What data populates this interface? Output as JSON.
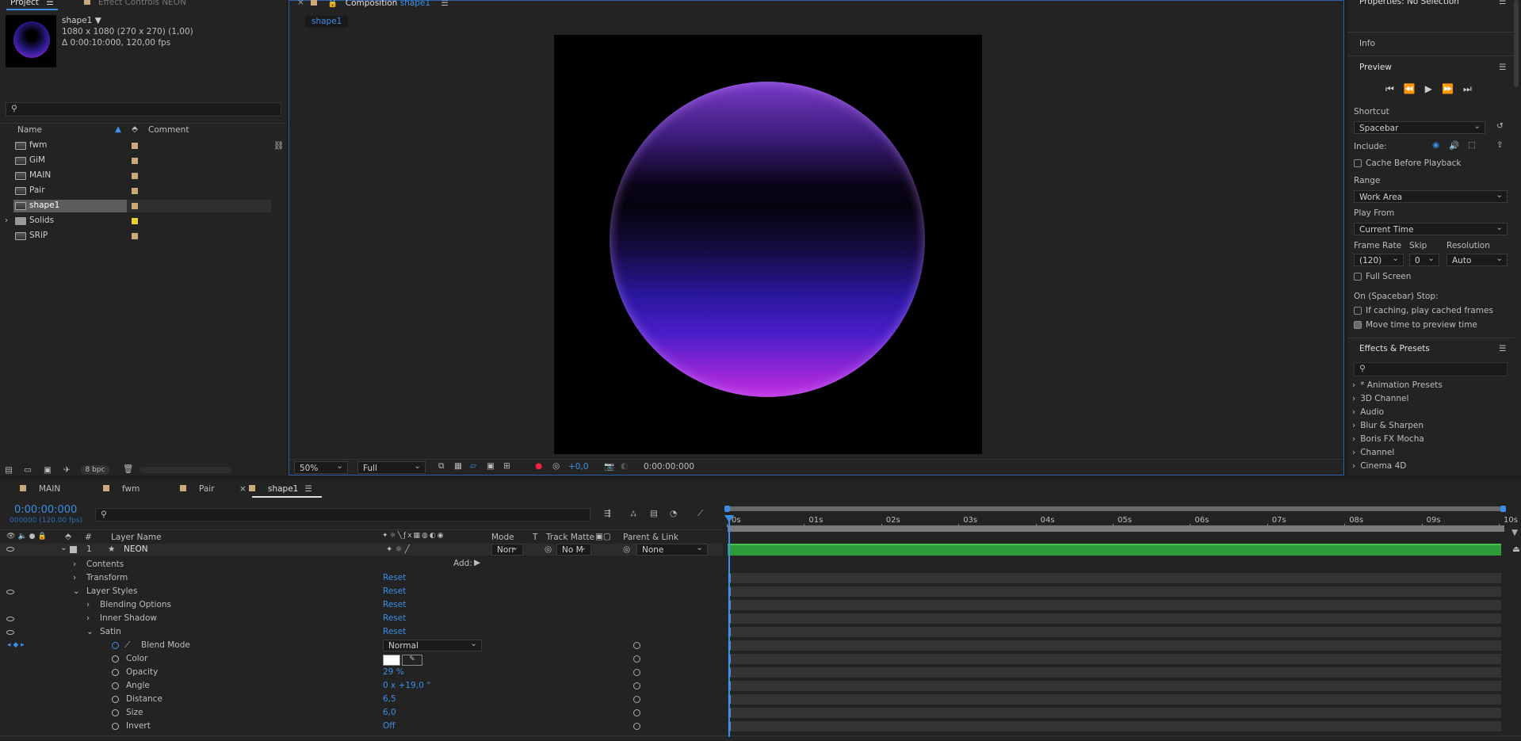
{
  "project": {
    "tab_label": "Project",
    "effect_controls_label": "Effect Controls NEON",
    "selected_name": "shape1 ▼",
    "selected_dims": "1080 x 1080  (270 x 270) (1,00)",
    "selected_duration": "Δ 0:00:10:000, 120,00 fps",
    "col_name": "Name",
    "col_comment": "Comment",
    "items": [
      {
        "name": "fwm",
        "type": "comp",
        "label_color": "#c8a977"
      },
      {
        "name": "GiM",
        "type": "comp",
        "label_color": "#c8a977"
      },
      {
        "name": "MAIN",
        "type": "comp",
        "label_color": "#c8a977"
      },
      {
        "name": "Pair",
        "type": "comp",
        "label_color": "#c8a977"
      },
      {
        "name": "shape1",
        "type": "comp",
        "label_color": "#c8a977"
      },
      {
        "name": "Solids",
        "type": "folder",
        "label_color": "#e8d23a"
      },
      {
        "name": "SRiP",
        "type": "comp",
        "label_color": "#c8a977"
      }
    ],
    "bpc": "8 bpc"
  },
  "composition": {
    "title_prefix": "Composition",
    "title_name": "shape1",
    "breadcrumb": "shape1",
    "zoom": "50%",
    "resolution": "Full",
    "exposure": "+0,0",
    "timecode": "0:00:00:000"
  },
  "right": {
    "properties_label": "Properties: No Selection",
    "info_label": "Info",
    "preview_label": "Preview",
    "shortcut_label": "Shortcut",
    "shortcut_value": "Spacebar",
    "include_label": "Include:",
    "cache_label": "Cache Before Playback",
    "range_label": "Range",
    "range_value": "Work Area",
    "play_from_label": "Play From",
    "play_from_value": "Current Time",
    "frame_rate_label": "Frame Rate",
    "skip_label": "Skip",
    "resolution_label": "Resolution",
    "frame_rate_value": "(120)",
    "skip_value": "0",
    "resolution_value": "Auto",
    "full_screen_label": "Full Screen",
    "stop_label": "On (Spacebar) Stop:",
    "if_caching_label": "If caching, play cached frames",
    "move_time_label": "Move time to preview time",
    "effects_label": "Effects & Presets",
    "effects_items": [
      "* Animation Presets",
      "3D Channel",
      "Audio",
      "Blur & Sharpen",
      "Boris FX Mocha",
      "Channel",
      "Cinema 4D"
    ]
  },
  "timeline": {
    "tabs": [
      {
        "label": "MAIN",
        "color": "#c8a977"
      },
      {
        "label": "fwm",
        "color": "#c8a977"
      },
      {
        "label": "Pair",
        "color": "#c8a977"
      },
      {
        "label": "shape1",
        "color": "#c8a977"
      }
    ],
    "timecode": "0:00:00:000",
    "timecode_sub": "000000 (120.00 fps)",
    "col_hash": "#",
    "col_layer_name": "Layer Name",
    "col_mode": "Mode",
    "col_t": "T",
    "col_track_matte": "Track Matte",
    "col_parent": "Parent & Link",
    "ruler": [
      "0s",
      "01s",
      "02s",
      "03s",
      "04s",
      "05s",
      "06s",
      "07s",
      "08s",
      "09s",
      "10s"
    ],
    "layer": {
      "index": "1",
      "name": "NEON",
      "mode": "Norr",
      "matte": "No M",
      "parent": "None"
    },
    "add_label": "Add:",
    "props": [
      {
        "name": "Contents",
        "level": 1,
        "value": ""
      },
      {
        "name": "Transform",
        "level": 1,
        "value": "Reset"
      },
      {
        "name": "Layer Styles",
        "level": 1,
        "value": "Reset"
      },
      {
        "name": "Blending Options",
        "level": 2,
        "value": "Reset"
      },
      {
        "name": "Inner Shadow",
        "level": 2,
        "value": "Reset"
      },
      {
        "name": "Satin",
        "level": 2,
        "value": "Reset"
      },
      {
        "name": "Blend Mode",
        "level": 3,
        "value": "Normal"
      },
      {
        "name": "Color",
        "level": 3,
        "value": ""
      },
      {
        "name": "Opacity",
        "level": 3,
        "value": "29 %"
      },
      {
        "name": "Angle",
        "level": 3,
        "value": "0 x +19,0 °"
      },
      {
        "name": "Distance",
        "level": 3,
        "value": "6,5"
      },
      {
        "name": "Size",
        "level": 3,
        "value": "6,0"
      },
      {
        "name": "Invert",
        "level": 3,
        "value": "Off"
      }
    ]
  }
}
